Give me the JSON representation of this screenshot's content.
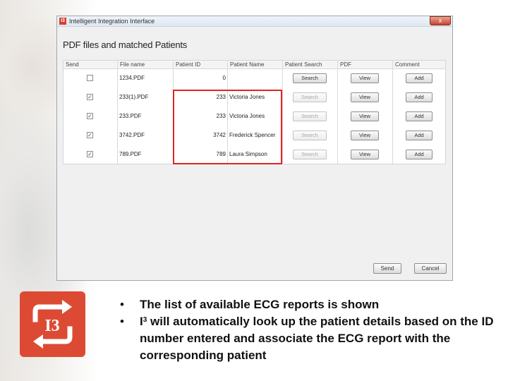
{
  "window": {
    "title": "Intelligent Integration Interface",
    "app_icon_label": "I3",
    "close_label": "x",
    "heading": "PDF files and matched Patients"
  },
  "grid": {
    "columns": [
      "Send",
      "File name",
      "Patient ID",
      "Patient Name",
      "Patient Search",
      "PDF",
      "Comment"
    ],
    "rows": [
      {
        "send": false,
        "file": "1234.PDF",
        "id": "0",
        "name": "",
        "search": "Search",
        "search_enabled": true,
        "pdf": "View",
        "comment": "Add"
      },
      {
        "send": true,
        "file": "233(1).PDF",
        "id": "233",
        "name": "Victoria Jones",
        "search": "Search",
        "search_enabled": false,
        "pdf": "View",
        "comment": "Add"
      },
      {
        "send": true,
        "file": "233.PDF",
        "id": "233",
        "name": "Victoria Jones",
        "search": "Search",
        "search_enabled": false,
        "pdf": "View",
        "comment": "Add"
      },
      {
        "send": true,
        "file": "3742.PDF",
        "id": "3742",
        "name": "Frederick Spencer",
        "search": "Search",
        "search_enabled": false,
        "pdf": "View",
        "comment": "Add"
      },
      {
        "send": true,
        "file": "789.PDF",
        "id": "789",
        "name": "Laura Simpson",
        "search": "Search",
        "search_enabled": false,
        "pdf": "View",
        "comment": "Add"
      }
    ]
  },
  "footer": {
    "send_label": "Send",
    "cancel_label": "Cancel"
  },
  "logo": {
    "text": "I3",
    "color": "#dd4a33"
  },
  "bullets": {
    "b1": "The list of available ECG reports is shown",
    "b2_prefix": "I",
    "b2_sup": "3",
    "b2_rest": " will automatically look up the patient details based on the ID number entered and associate the ECG report with the corresponding patient",
    "marker": "•"
  },
  "colors": {
    "highlight": "#e02424",
    "check": "#2a3f8c"
  }
}
